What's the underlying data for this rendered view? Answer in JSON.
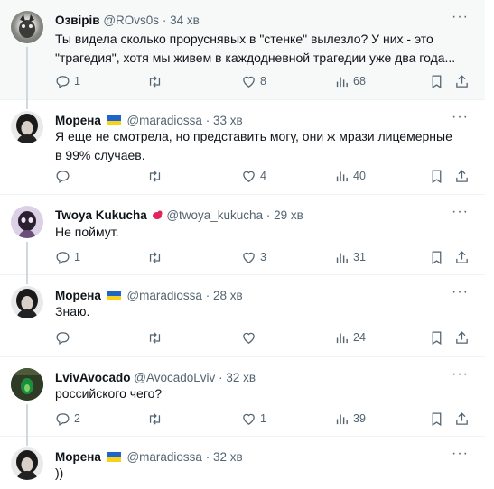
{
  "tweets": [
    {
      "name": "Озвірів",
      "handle": "@ROvs0s",
      "time": "34 хв",
      "flag": false,
      "text": "Ты видела сколько проруснявых в \"стенке\" вылезло? У них - это \"трагедия\", хотя мы живем в каждодневной трагедии уже два года...",
      "replies": "1",
      "retweets": "",
      "likes": "8",
      "views": "68"
    },
    {
      "name": "Морена",
      "handle": "@maradiossa",
      "time": "33 хв",
      "flag": true,
      "text": "Я еще не смотрела, но представить могу, они ж мрази лицемерные в 99% случаев.",
      "replies": "",
      "retweets": "",
      "likes": "4",
      "views": "40"
    },
    {
      "name": "Twoya Kukucha",
      "handle": "@twoya_kukucha",
      "time": "29 хв",
      "flag": false,
      "text": "Не поймут.",
      "replies": "1",
      "retweets": "",
      "likes": "3",
      "views": "31"
    },
    {
      "name": "Морена",
      "handle": "@maradiossa",
      "time": "28 хв",
      "flag": true,
      "text": "Знаю.",
      "replies": "",
      "retweets": "",
      "likes": "",
      "views": "24"
    },
    {
      "name": "LvivAvocado",
      "handle": "@AvocadoLviv",
      "time": "32 хв",
      "flag": false,
      "text": "российского чего?",
      "replies": "2",
      "retweets": "",
      "likes": "1",
      "views": "39"
    },
    {
      "name": "Морена",
      "handle": "@maradiossa",
      "time": "32 хв",
      "flag": true,
      "text": "))",
      "replies": "",
      "retweets": "",
      "likes": "",
      "views": ""
    }
  ],
  "separator": "·",
  "more_label": "···",
  "colors": {
    "text": "#0f1419",
    "muted": "#536471",
    "thread_line": "#cfd9de",
    "highlight_bg": "#f7f9f9",
    "flag_blue": "#1f64c8",
    "flag_yellow": "#f7d21c"
  },
  "icons": [
    "reply-icon",
    "retweet-icon",
    "like-icon",
    "views-icon",
    "bookmark-icon",
    "share-icon",
    "more-icon"
  ]
}
